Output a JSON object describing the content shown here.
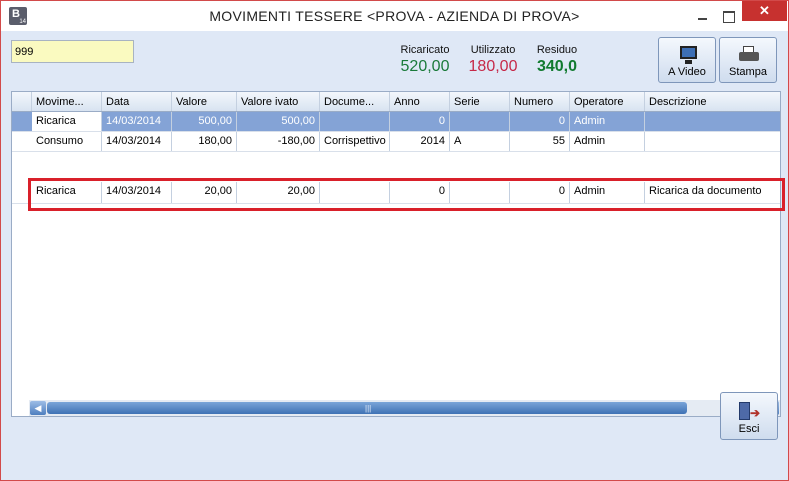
{
  "window": {
    "title": "MOVIMENTI TESSERE <PROVA - AZIENDA DI PROVA>",
    "close_symbol": "✕",
    "icon_letter": "B",
    "icon_sub": "14"
  },
  "filter": {
    "value": "999"
  },
  "summary": {
    "ricaricato": {
      "label": "Ricaricato",
      "value": "520,00"
    },
    "utilizzato": {
      "label": "Utilizzato",
      "value": "180,00"
    },
    "residuo": {
      "label": "Residuo",
      "value": "340,0"
    }
  },
  "buttons": {
    "video": "A Video",
    "stampa": "Stampa",
    "esci": "Esci"
  },
  "grid": {
    "columns": [
      "Movime...",
      "Data",
      "Valore",
      "Valore ivato",
      "Docume...",
      "Anno",
      "Serie",
      "Numero",
      "Operatore",
      "Descrizione"
    ],
    "rows": [
      {
        "movimento": "Ricarica",
        "data": "14/03/2014",
        "valore": "500,00",
        "valore_ivato": "500,00",
        "documento": "",
        "anno": "0",
        "serie": "",
        "numero": "0",
        "operatore": "Admin",
        "descrizione": ""
      },
      {
        "movimento": "Consumo",
        "data": "14/03/2014",
        "valore": "180,00",
        "valore_ivato": "-180,00",
        "documento": "Corrispettivo",
        "anno": "2014",
        "serie": "A",
        "numero": "55",
        "operatore": "Admin",
        "descrizione": ""
      },
      {
        "movimento": "Ricarica",
        "data": "14/03/2014",
        "valore": "20,00",
        "valore_ivato": "20,00",
        "documento": "",
        "anno": "0",
        "serie": "",
        "numero": "0",
        "operatore": "Admin",
        "descrizione": "Ricarica da documento"
      }
    ]
  },
  "colors": {
    "accent": "#d9202a",
    "selection": "#84a3d6",
    "ricaricato": "#1a7a3a",
    "utilizzato": "#c62848",
    "residuo": "#117a2f"
  },
  "icons": [
    "monitor-icon",
    "printer-icon",
    "exit-door-icon",
    "filter-icon",
    "anchor-icon",
    "search-icon"
  ]
}
